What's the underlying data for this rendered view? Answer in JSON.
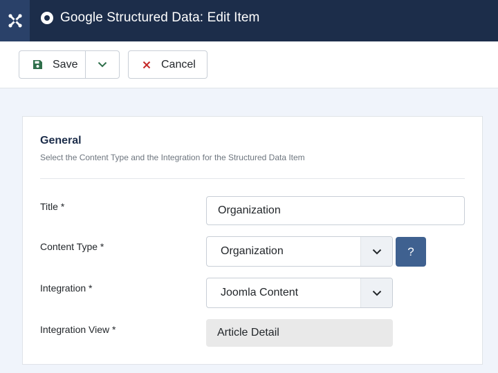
{
  "header": {
    "title": "Google Structured Data: Edit Item",
    "logo_icon": "joomla-logo-icon",
    "title_icon": "record-icon"
  },
  "toolbar": {
    "save_label": "Save",
    "cancel_label": "Cancel",
    "save_icon": "floppy-disk-icon",
    "dropdown_icon": "chevron-down-icon",
    "cancel_icon": "close-icon",
    "save_icon_color": "#2f6f4b",
    "cancel_icon_color": "#c52827"
  },
  "form": {
    "legend": "General",
    "description": "Select the Content Type and the Integration for the Structured Data Item",
    "fields": {
      "title": {
        "label": "Title *",
        "value": "Organization"
      },
      "content_type": {
        "label": "Content Type *",
        "value": "Organization",
        "help_label": "?"
      },
      "integration": {
        "label": "Integration *",
        "value": "Joomla Content"
      },
      "integration_view": {
        "label": "Integration View *",
        "value": "Article Detail"
      }
    }
  },
  "colors": {
    "header_bg": "#1c2d4a",
    "logo_bg": "#2a4169",
    "help_button": "#3f6190",
    "page_bg": "#f0f4fb"
  }
}
